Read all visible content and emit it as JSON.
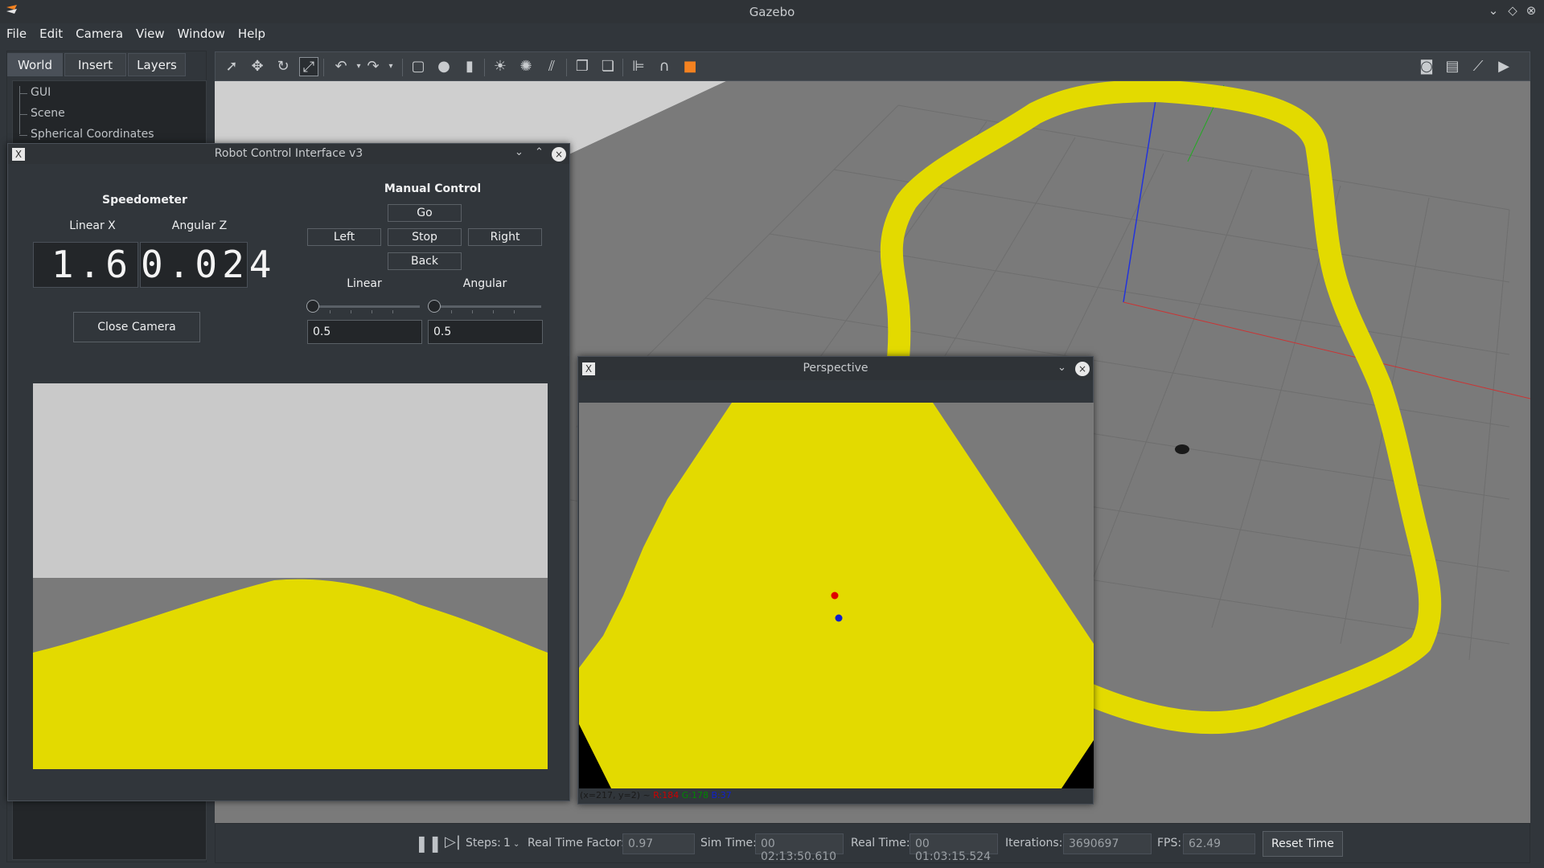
{
  "window": {
    "title": "Gazebo"
  },
  "menu": [
    "File",
    "Edit",
    "Camera",
    "View",
    "Window",
    "Help"
  ],
  "left_panel": {
    "tabs": [
      "World",
      "Insert",
      "Layers"
    ],
    "tree": [
      "GUI",
      "Scene",
      "Spherical Coordinates"
    ]
  },
  "robot_window": {
    "title": "Robot Control Interface v3",
    "speedometer_title": "Speedometer",
    "linear_label": "Linear X",
    "angular_label": "Angular Z",
    "linear_value": "1.6",
    "angular_value": "0.024",
    "close_camera": "Close Camera",
    "manual_title": "Manual Control",
    "go": "Go",
    "left": "Left",
    "stop": "Stop",
    "right": "Right",
    "back": "Back",
    "linear_slider_label": "Linear",
    "angular_slider_label": "Angular",
    "linear_input": "0.5",
    "angular_input": "0.5"
  },
  "perspective_window": {
    "title": "Perspective",
    "pixel_info": "(x=217, y=2) ~",
    "r": "R:184",
    "g": "G:178",
    "b": "B:37"
  },
  "status": {
    "steps_label": "Steps:",
    "steps_value": "1",
    "rtf_label": "Real Time Factor:",
    "rtf_value": "0.97",
    "sim_label": "Sim Time:",
    "sim_value": "00 02:13:50.610",
    "real_label": "Real Time:",
    "real_value": "00 01:03:15.524",
    "iter_label": "Iterations:",
    "iter_value": "3690697",
    "fps_label": "FPS:",
    "fps_value": "62.49",
    "reset_label": "Reset Time"
  },
  "colors": {
    "track_yellow": "#e3da00",
    "ground": "#7a7a7a",
    "dark_bg": "#31363b"
  }
}
